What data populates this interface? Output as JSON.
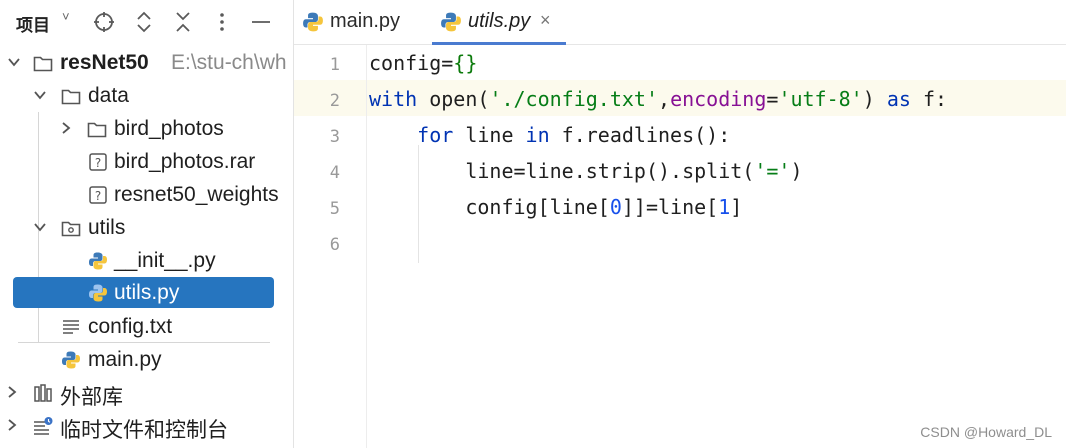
{
  "sidebar": {
    "title": "项目",
    "caret": "˅",
    "tree": [
      {
        "label": "resNet50",
        "hint": "E:\\stu-ch\\wh"
      },
      {
        "label": "data"
      },
      {
        "label": "bird_photos"
      },
      {
        "label": "bird_photos.rar"
      },
      {
        "label": "resnet50_weights"
      },
      {
        "label": "utils"
      },
      {
        "label": "__init__.py"
      },
      {
        "label": "utils.py"
      },
      {
        "label": "config.txt"
      },
      {
        "label": "main.py"
      },
      {
        "label": "外部库"
      },
      {
        "label": "临时文件和控制台"
      }
    ]
  },
  "tabs": [
    {
      "label": "main.py"
    },
    {
      "label": "utils.py",
      "close": "×"
    }
  ],
  "editor": {
    "line_numbers": [
      "1",
      "2",
      "3",
      "4",
      "5",
      "6"
    ],
    "lines": [
      [
        {
          "t": "config",
          "c": "plain"
        },
        {
          "t": "=",
          "c": "plain"
        },
        {
          "t": "{}",
          "c": "brace"
        }
      ],
      [
        {
          "t": "with ",
          "c": "kw"
        },
        {
          "t": "open",
          "c": "plain"
        },
        {
          "t": "(",
          "c": "plain"
        },
        {
          "t": "'./config.txt'",
          "c": "str"
        },
        {
          "t": ",",
          "c": "plain"
        },
        {
          "t": "encoding",
          "c": "var"
        },
        {
          "t": "=",
          "c": "plain"
        },
        {
          "t": "'utf-8'",
          "c": "str"
        },
        {
          "t": ") ",
          "c": "plain"
        },
        {
          "t": "as ",
          "c": "kw"
        },
        {
          "t": "f:",
          "c": "plain"
        }
      ],
      [
        {
          "t": "    for ",
          "c": "kw"
        },
        {
          "t": "line ",
          "c": "plain"
        },
        {
          "t": "in ",
          "c": "kw"
        },
        {
          "t": "f.readlines():",
          "c": "plain"
        }
      ],
      [
        {
          "t": "        line",
          "c": "plain"
        },
        {
          "t": "=",
          "c": "plain"
        },
        {
          "t": "line.strip().split(",
          "c": "plain"
        },
        {
          "t": "'='",
          "c": "str"
        },
        {
          "t": ")",
          "c": "plain"
        }
      ],
      [
        {
          "t": "        config[line[",
          "c": "plain"
        },
        {
          "t": "0",
          "c": "num"
        },
        {
          "t": "]]",
          "c": "plain"
        },
        {
          "t": "=",
          "c": "plain"
        },
        {
          "t": "line[",
          "c": "plain"
        },
        {
          "t": "1",
          "c": "num"
        },
        {
          "t": "]",
          "c": "plain"
        }
      ],
      []
    ]
  },
  "watermark": "CSDN @Howard_DL"
}
